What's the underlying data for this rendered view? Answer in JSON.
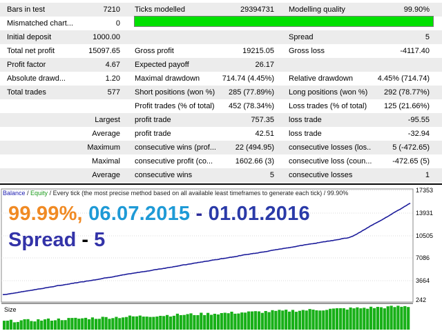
{
  "report": {
    "rows": [
      {
        "c1_label": "Bars in test",
        "c1_value": "7210",
        "c2_label": "Ticks modelled",
        "c2_value": "29394731",
        "c3_label": "Modelling quality",
        "c3_value": "99.90%"
      },
      {
        "c1_label": "Mismatched chart...",
        "c1_value": "0",
        "c2_label": "",
        "c2_value": "",
        "c3_label": "",
        "c3_value": ""
      },
      {
        "c1_label": "Initial deposit",
        "c1_value": "1000.00",
        "c2_label": "",
        "c2_value": "",
        "c3_label": "Spread",
        "c3_value": "5"
      },
      {
        "c1_label": "Total net profit",
        "c1_value": "15097.65",
        "c2_label": "Gross profit",
        "c2_value": "19215.05",
        "c3_label": "Gross loss",
        "c3_value": "-4117.40"
      },
      {
        "c1_label": "Profit factor",
        "c1_value": "4.67",
        "c2_label": "Expected payoff",
        "c2_value": "26.17",
        "c3_label": "",
        "c3_value": ""
      },
      {
        "c1_label": "Absolute drawd...",
        "c1_value": "1.20",
        "c2_label": "Maximal drawdown",
        "c2_value": "714.74 (4.45%)",
        "c3_label": "Relative drawdown",
        "c3_value": "4.45% (714.74)"
      },
      {
        "c1_label": "Total trades",
        "c1_value": "577",
        "c2_label": "Short positions (won %)",
        "c2_value": "285 (77.89%)",
        "c3_label": "Long positions (won %)",
        "c3_value": "292 (78.77%)"
      },
      {
        "c1_label": "",
        "c1_value": "",
        "c2_label": "Profit trades (% of total)",
        "c2_value": "452 (78.34%)",
        "c3_label": "Loss trades (% of total)",
        "c3_value": "125 (21.66%)"
      },
      {
        "c1_label": "",
        "c1_value": "Largest",
        "c2_label": "profit trade",
        "c2_value": "757.35",
        "c3_label": "loss trade",
        "c3_value": "-95.55"
      },
      {
        "c1_label": "",
        "c1_value": "Average",
        "c2_label": "profit trade",
        "c2_value": "42.51",
        "c3_label": "loss trade",
        "c3_value": "-32.94"
      },
      {
        "c1_label": "",
        "c1_value": "Maximum",
        "c2_label": "consecutive wins (prof...",
        "c2_value": "22 (494.95)",
        "c3_label": "consecutive losses (los...",
        "c3_value": "5 (-472.65)"
      },
      {
        "c1_label": "",
        "c1_value": "Maximal",
        "c2_label": "consecutive profit (co...",
        "c2_value": "1602.66 (3)",
        "c3_label": "consecutive loss (coun...",
        "c3_value": "-472.65 (5)"
      },
      {
        "c1_label": "",
        "c1_value": "Average",
        "c2_label": "consecutive wins",
        "c2_value": "5",
        "c3_label": "consecutive losses",
        "c3_value": "1"
      }
    ],
    "modelling_bar_color": "#00e000"
  },
  "chart": {
    "legend_balance": "Balance",
    "legend_sep": " / ",
    "legend_equity": "Equity",
    "legend_rest": " / Every tick (the most precise method based on all available least timeframes to generate each tick) / 99.90%",
    "overlay_pct": "99.99%,",
    "overlay_dates_a": "06.07.2015",
    "overlay_dash": " - ",
    "overlay_dates_b": "01.01.2016",
    "overlay_spread_label": "Spread",
    "overlay_spread_dash": " - ",
    "overlay_spread_value": "5",
    "colors": {
      "pct": "#f08a24",
      "date_a": "#1e9ad6",
      "dash": "#2a2a9a",
      "date_b": "#2a3aa8",
      "spread": "#3333a8",
      "balance_line": "#1b1b9a",
      "equity_line": "#19a019",
      "size_bars": "#18b018"
    },
    "y_ticks": [
      "17353",
      "13931",
      "10505",
      "7086",
      "3664",
      "242"
    ],
    "size_label": "Size",
    "trades": 577,
    "balance_start": 1000,
    "balance_end": 16097.65,
    "balance_max": 17353
  }
}
